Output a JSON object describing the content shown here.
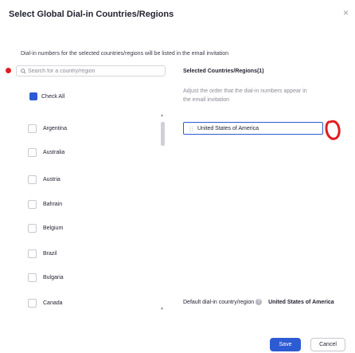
{
  "dialog": {
    "title": "Select Global Dial-in Countries/Regions",
    "close_glyph": "×",
    "info_text": "Dial-in numbers for the selected countries/regions will be listed in the email invitation"
  },
  "search": {
    "placeholder": "Search for a country/region",
    "value": ""
  },
  "check_all": {
    "label": "Check All",
    "checked": true
  },
  "countries": [
    {
      "name": "Argentina",
      "checked": false
    },
    {
      "name": "Australia",
      "checked": false
    },
    {
      "name": "Austria",
      "checked": false
    },
    {
      "name": "Bahrain",
      "checked": false
    },
    {
      "name": "Belgium",
      "checked": false
    },
    {
      "name": "Brazil",
      "checked": false
    },
    {
      "name": "Bulgaria",
      "checked": false
    },
    {
      "name": "Canada",
      "checked": false
    }
  ],
  "selected_panel": {
    "heading": "Selected Countries/Regions(1)",
    "hint": "Adjust the order that the dial-in numbers appear in the email invitation",
    "items": [
      "United States of America"
    ]
  },
  "default_region": {
    "label": "Default dial-in country/region",
    "info_glyph": "?",
    "value": "United States of America"
  },
  "buttons": {
    "save": "Save",
    "cancel": "Cancel"
  },
  "icons": {
    "search": "search-icon",
    "drag_handle": "drag-handle-icon",
    "close": "close-icon",
    "info": "info-icon"
  },
  "colors": {
    "accent": "#2d5bd3",
    "annotation_red": "#e11d21",
    "text": "#232333",
    "muted": "#8b8b96"
  }
}
